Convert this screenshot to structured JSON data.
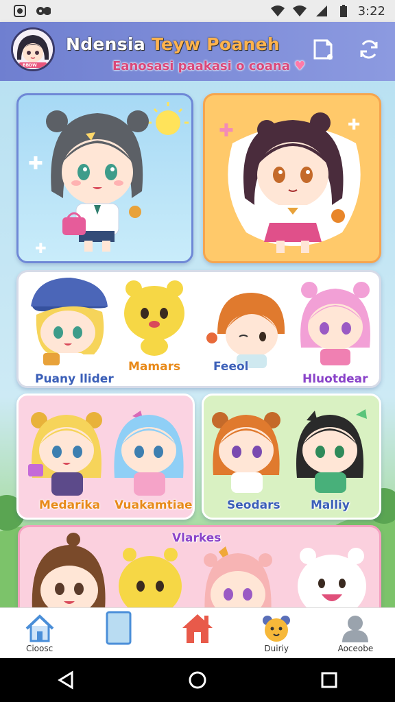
{
  "status_bar": {
    "time": "3:22",
    "left_icons": [
      "notification-icon",
      "game-icon"
    ],
    "right_icons": [
      "wifi-icon",
      "signal-icon",
      "signal-icon",
      "battery-icon"
    ]
  },
  "header": {
    "title_part1": "Ndensia ",
    "title_part2": "Teyw Poaneh",
    "subtitle": "Eanosasi paakasi o coana",
    "subtitle_icon": "heart-icon",
    "badge": "BBDW",
    "buttons": [
      "sticker-icon",
      "refresh-icon"
    ]
  },
  "cards": {
    "group_labels": [
      "Puany llider",
      "Mamars",
      "Feeol",
      "Hluotdear"
    ],
    "pink_labels": [
      "Medarika",
      "Vuakamtiae"
    ],
    "green_labels": [
      "Seodars",
      "Malliy"
    ],
    "bottom_title": "Vlarkes"
  },
  "bottom_nav": [
    {
      "label": "Cioosc",
      "icon": "home-outline-icon"
    },
    {
      "label": "",
      "icon": "tablet-icon"
    },
    {
      "label": "",
      "icon": "home-filled-icon"
    },
    {
      "label": "Duiriy",
      "icon": "bear-icon"
    },
    {
      "label": "Aoceobe",
      "icon": "profile-icon"
    }
  ],
  "colors": {
    "header": "#7f8fd8",
    "accent_pink": "#e44b7f",
    "label_orange": "#e88a1a",
    "label_blue": "#3b5fb8",
    "label_purple": "#8a43c9"
  }
}
